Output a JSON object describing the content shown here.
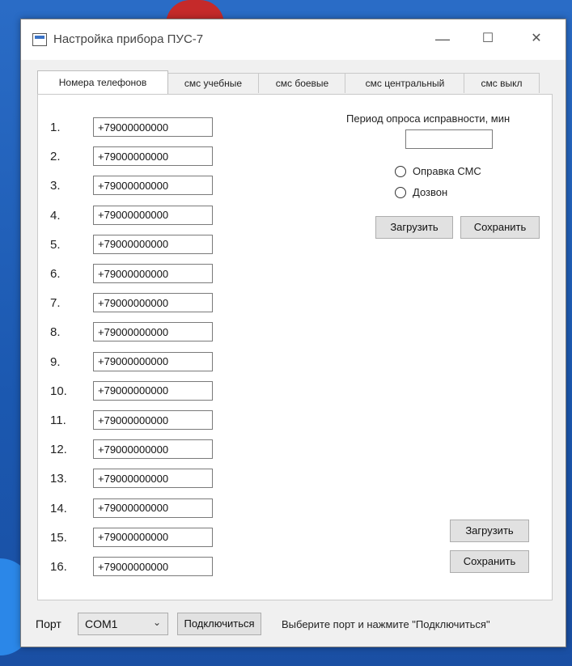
{
  "window": {
    "title": "Настройка прибора ПУС-7",
    "minimize": "—",
    "maximize": "☐",
    "close": "✕"
  },
  "tabs": [
    {
      "label": "Номера телефонов",
      "active": true
    },
    {
      "label": "смс учебные",
      "active": false
    },
    {
      "label": "смс боевые",
      "active": false
    },
    {
      "label": "смс центральный",
      "active": false
    },
    {
      "label": "смс выкл",
      "active": false
    }
  ],
  "phones": [
    {
      "index": "1.",
      "value": "+79000000000"
    },
    {
      "index": "2.",
      "value": "+79000000000"
    },
    {
      "index": "3.",
      "value": "+79000000000"
    },
    {
      "index": "4.",
      "value": "+79000000000"
    },
    {
      "index": "5.",
      "value": "+79000000000"
    },
    {
      "index": "6.",
      "value": "+79000000000"
    },
    {
      "index": "7.",
      "value": "+79000000000"
    },
    {
      "index": "8.",
      "value": "+79000000000"
    },
    {
      "index": "9.",
      "value": "+79000000000"
    },
    {
      "index": "10.",
      "value": "+79000000000"
    },
    {
      "index": "11.",
      "value": "+79000000000"
    },
    {
      "index": "12.",
      "value": "+79000000000"
    },
    {
      "index": "13.",
      "value": "+79000000000"
    },
    {
      "index": "14.",
      "value": "+79000000000"
    },
    {
      "index": "15.",
      "value": "+79000000000"
    },
    {
      "index": "16.",
      "value": "+79000000000"
    }
  ],
  "settings": {
    "period_label": "Период опроса исправности, мин",
    "period_value": "",
    "radio_sms": "Оправка СМС",
    "radio_call": "Дозвон",
    "load_label": "Загрузить",
    "save_label": "Сохранить"
  },
  "phone_actions": {
    "load_label": "Загрузить",
    "save_label": "Сохранить"
  },
  "bottom": {
    "port_label": "Порт",
    "port_value": "COM1",
    "connect_label": "Подключиться",
    "status": "Выберите порт и нажмите \"Подключиться\""
  }
}
